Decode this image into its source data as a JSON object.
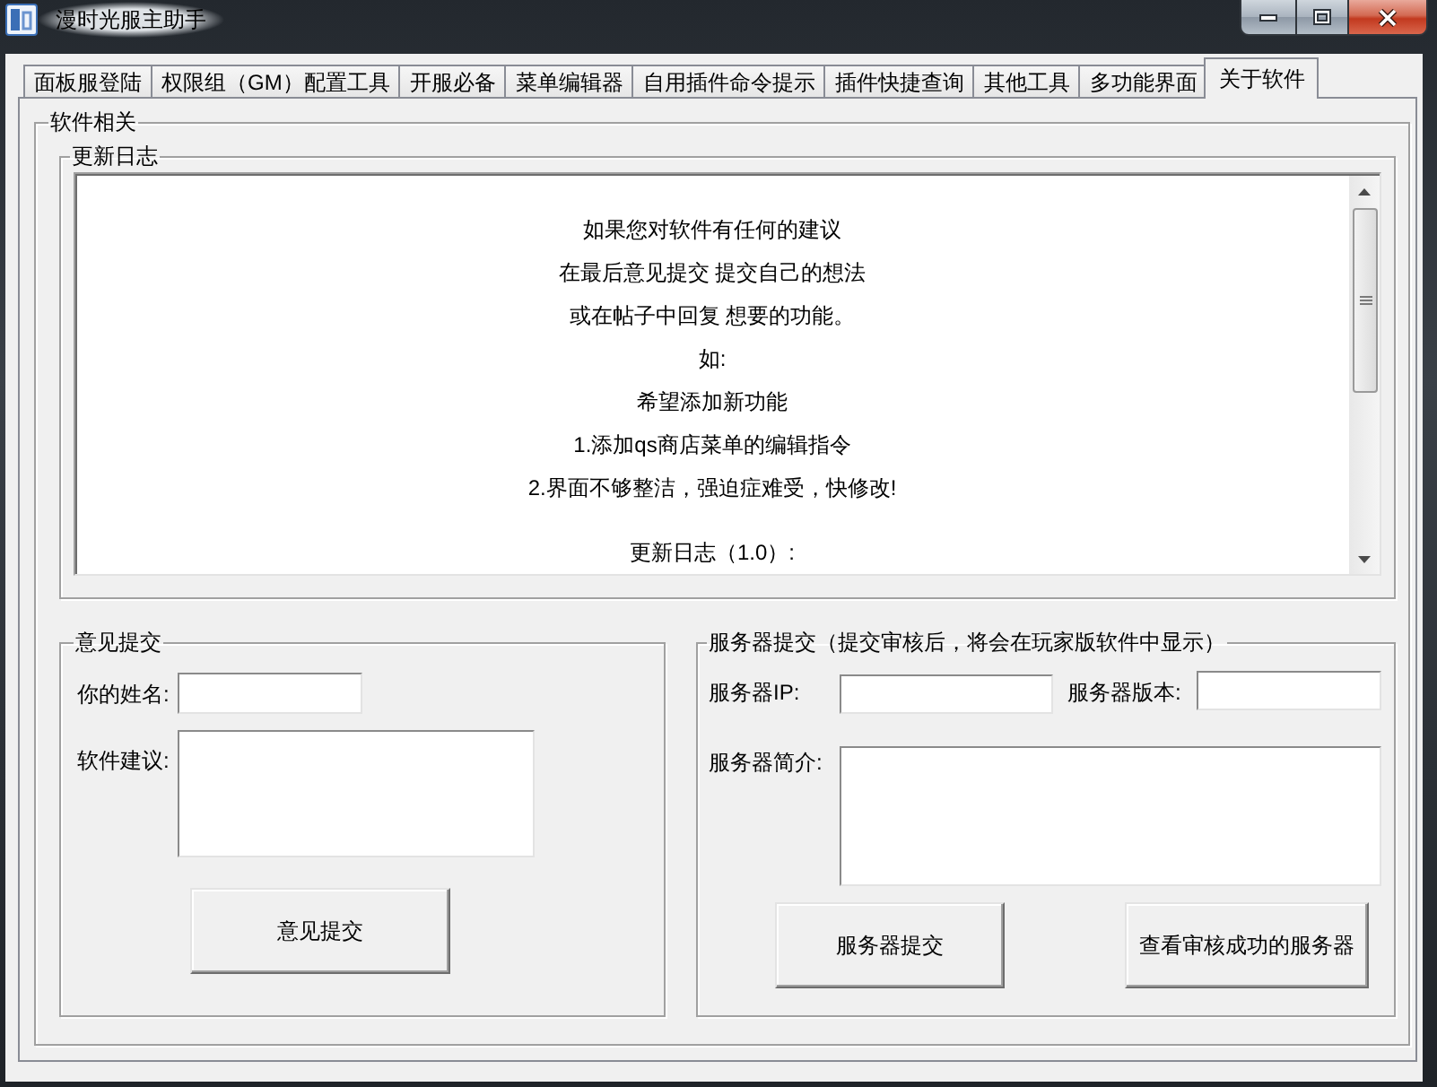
{
  "window": {
    "title": "漫时光服主助手"
  },
  "tabs": [
    {
      "label": "面板服登陆",
      "selected": false
    },
    {
      "label": "权限组（GM）配置工具",
      "selected": false
    },
    {
      "label": "开服必备",
      "selected": false
    },
    {
      "label": "菜单编辑器",
      "selected": false
    },
    {
      "label": "自用插件命令提示",
      "selected": false
    },
    {
      "label": "插件快捷查询",
      "selected": false
    },
    {
      "label": "其他工具",
      "selected": false
    },
    {
      "label": "多功能界面",
      "selected": false
    },
    {
      "label": "关于软件",
      "selected": true
    }
  ],
  "about_panel": {
    "title": "软件相关",
    "changelog": {
      "title": "更新日志",
      "paragraphs": [
        [
          "如果您对软件有任何的建议",
          "在最后意见提交 提交自己的想法",
          "或在帖子中回复 想要的功能。",
          "如:",
          "希望添加新功能",
          "1.添加qs商店菜单的编辑指令",
          "2.界面不够整洁，强迫症难受，快修改!"
        ],
        [
          "更新日志（1.0）:"
        ]
      ]
    },
    "feedback": {
      "title": "意见提交",
      "name_label": "你的姓名:",
      "suggestion_label": "软件建议:",
      "submit_button": "意见提交"
    },
    "server_submission": {
      "title": "服务器提交（提交审核后，将会在玩家版软件中显示）",
      "ip_label": "服务器IP:",
      "version_label": "服务器版本:",
      "intro_label": "服务器简介:",
      "buttons": [
        "服务器提交",
        "查看审核成功的服务器"
      ]
    }
  }
}
